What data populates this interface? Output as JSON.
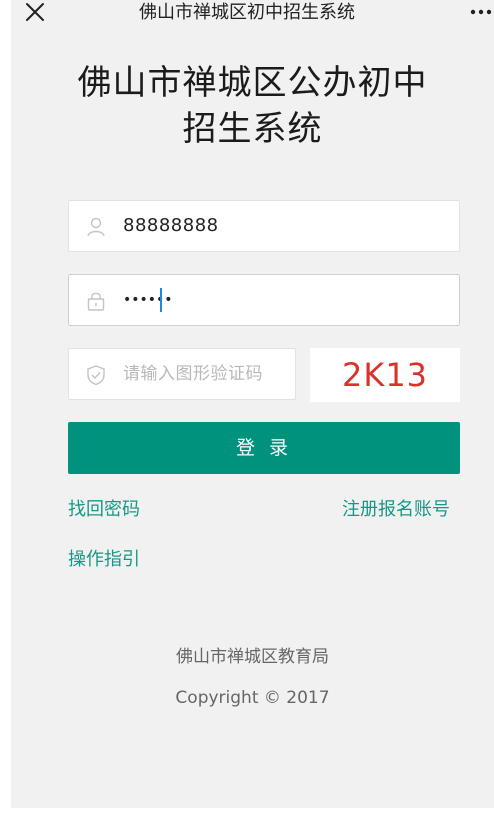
{
  "topbar": {
    "title": "佛山市禅城区初中招生系统",
    "close_icon": "close-icon",
    "more_icon": "more-dots-icon"
  },
  "heading": {
    "line1": "佛山市禅城区公办初中",
    "line2": "招生系统"
  },
  "form": {
    "username": {
      "value": "88888888",
      "icon": "user-icon"
    },
    "password": {
      "value": "••••••",
      "icon": "lock-icon"
    },
    "captcha": {
      "placeholder": "请输入图形验证码",
      "icon": "shield-icon",
      "image_text": "2K13"
    }
  },
  "login_button": {
    "label": "登 录"
  },
  "links": {
    "forgot_password": "找回密码",
    "register": "注册报名账号",
    "guide": "操作指引"
  },
  "footer": {
    "org": "佛山市禅城区教育局",
    "copyright": "Copyright © 2017"
  },
  "colors": {
    "accent": "#00927c",
    "link": "#159986",
    "captcha": "#d9322a",
    "background": "#f1f1f1"
  }
}
